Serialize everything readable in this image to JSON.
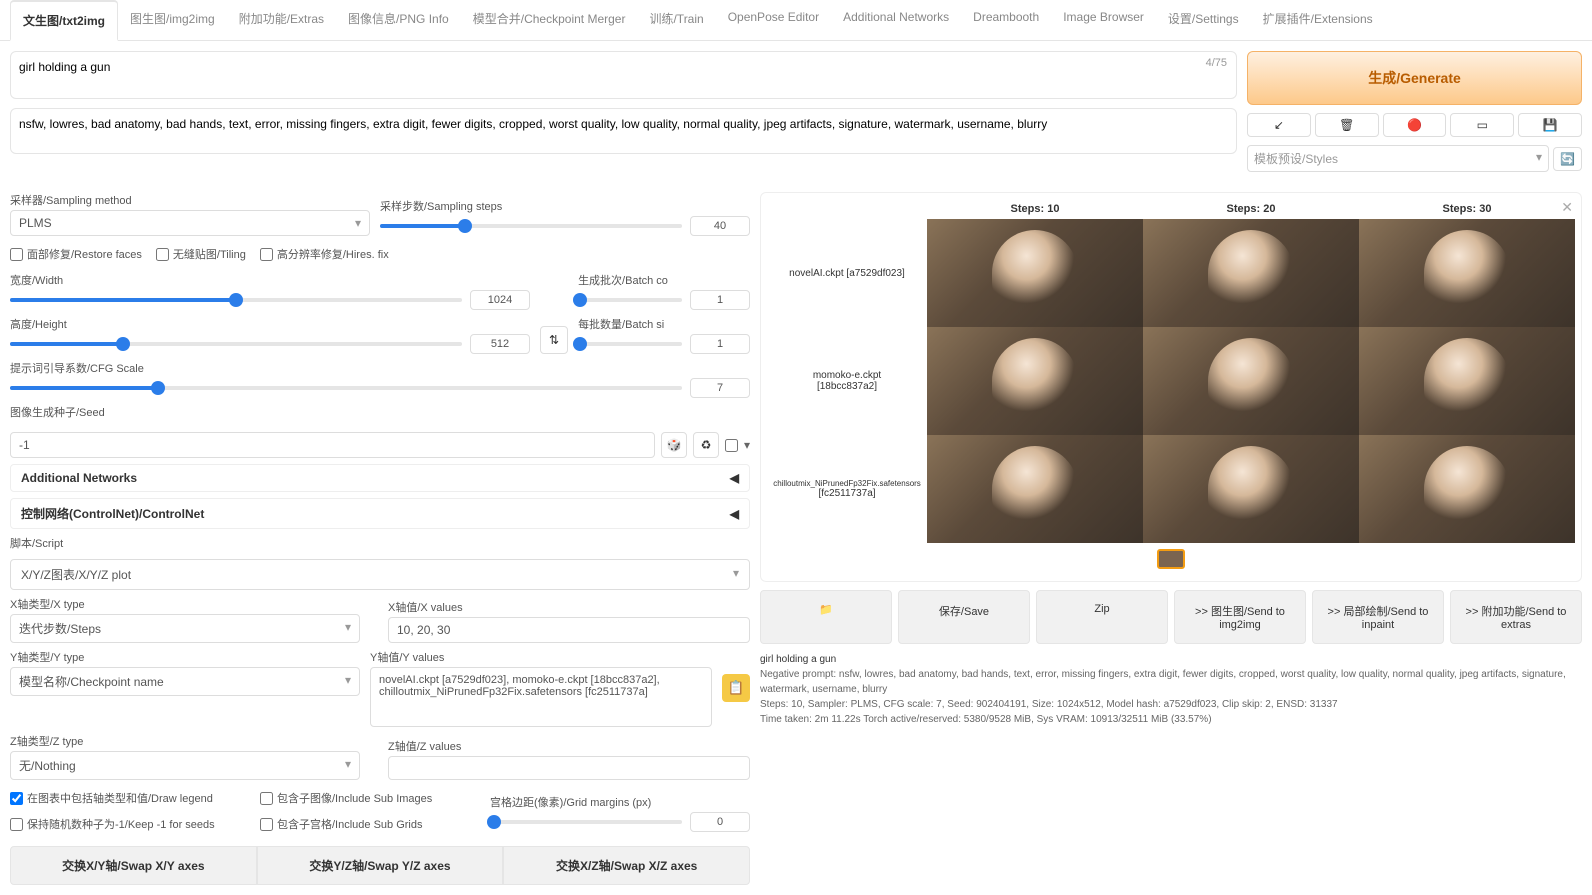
{
  "tabs": [
    "文生图/txt2img",
    "图生图/img2img",
    "附加功能/Extras",
    "图像信息/PNG Info",
    "模型合并/Checkpoint Merger",
    "训练/Train",
    "OpenPose Editor",
    "Additional Networks",
    "Dreambooth",
    "Image Browser",
    "设置/Settings",
    "扩展插件/Extensions"
  ],
  "prompt": "girl holding a gun",
  "token_count": "4/75",
  "neg_prompt": "nsfw, lowres, bad anatomy, bad hands, text, error, missing fingers, extra digit, fewer digits, cropped, worst quality, low quality, normal quality, jpeg artifacts, signature, watermark, username, blurry",
  "generate": "生成/Generate",
  "styles_label": "模板预设/Styles",
  "small_icons": [
    "↙",
    "🗑",
    "🔴",
    "▭",
    "💾"
  ],
  "sampling_label": "采样器/Sampling method",
  "sampling_value": "PLMS",
  "steps_label": "采样步数/Sampling steps",
  "steps_value": "40",
  "restore_faces": "面部修复/Restore faces",
  "tiling": "无缝贴图/Tiling",
  "hires": "高分辨率修复/Hires. fix",
  "width_label": "宽度/Width",
  "width_value": "1024",
  "height_label": "高度/Height",
  "height_value": "512",
  "batch_count_label": "生成批次/Batch co",
  "batch_count_value": "1",
  "batch_size_label": "每批数量/Batch si",
  "batch_size_value": "1",
  "cfg_label": "提示词引导系数/CFG Scale",
  "cfg_value": "7",
  "seed_label": "图像生成种子/Seed",
  "seed_value": "-1",
  "additional_networks": "Additional Networks",
  "controlnet": "控制网络(ControlNet)/ControlNet",
  "script_label": "脚本/Script",
  "script_value": "X/Y/Z图表/X/Y/Z plot",
  "xtype_label": "X轴类型/X type",
  "xtype_value": "迭代步数/Steps",
  "xvalues_label": "X轴值/X values",
  "xvalues_value": "10, 20, 30",
  "ytype_label": "Y轴类型/Y type",
  "ytype_value": "模型名称/Checkpoint name",
  "yvalues_label": "Y轴值/Y values",
  "yvalues_value": "novelAI.ckpt [a7529df023], momoko-e.ckpt [18bcc837a2], chilloutmix_NiPrunedFp32Fix.safetensors [fc2511737a]",
  "ztype_label": "Z轴类型/Z type",
  "ztype_value": "无/Nothing",
  "zvalues_label": "Z轴值/Z values",
  "draw_legend": "在图表中包括轴类型和值/Draw legend",
  "include_sub_images": "包含子图像/Include Sub Images",
  "keep_seeds": "保持随机数种子为-1/Keep -1 for seeds",
  "include_sub_grids": "包含子宫格/Include Sub Grids",
  "grid_margins_label": "宫格边距(像素)/Grid margins (px)",
  "grid_margins_value": "0",
  "swap_xy": "交换X/Y轴/Swap X/Y axes",
  "swap_yz": "交换Y/Z轴/Swap Y/Z axes",
  "swap_xz": "交换X/Z轴/Swap X/Z axes",
  "grid_cols": [
    "Steps: 10",
    "Steps: 20",
    "Steps: 30"
  ],
  "grid_rows": [
    {
      "l1": "novelAI.ckpt [a7529df023]",
      "l2": ""
    },
    {
      "l1": "momoko-e.ckpt",
      "l2": "[18bcc837a2]"
    },
    {
      "l1": "chilloutmix_NiPrunedFp32Fix.safetensors",
      "l2": "[fc2511737a]"
    }
  ],
  "actions": {
    "folder": "📁",
    "save": "保存/Save",
    "zip": "Zip",
    "i2i": ">> 图生图/Send to img2img",
    "inpaint": ">> 局部绘制/Send to inpaint",
    "extras": ">> 附加功能/Send to extras"
  },
  "info_prompt": "girl holding a gun",
  "info_neg": "Negative prompt: nsfw, lowres, bad anatomy, bad hands, text, error, missing fingers, extra digit, fewer digits, cropped, worst quality, low quality, normal quality, jpeg artifacts, signature, watermark, username, blurry",
  "info_params": "Steps: 10, Sampler: PLMS, CFG scale: 7, Seed: 902404191, Size: 1024x512, Model hash: a7529df023, Clip skip: 2, ENSD: 31337",
  "info_time": "Time taken: 2m 11.22s   Torch active/reserved: 5380/9528 MiB, Sys VRAM: 10913/32511 MiB (33.57%)"
}
